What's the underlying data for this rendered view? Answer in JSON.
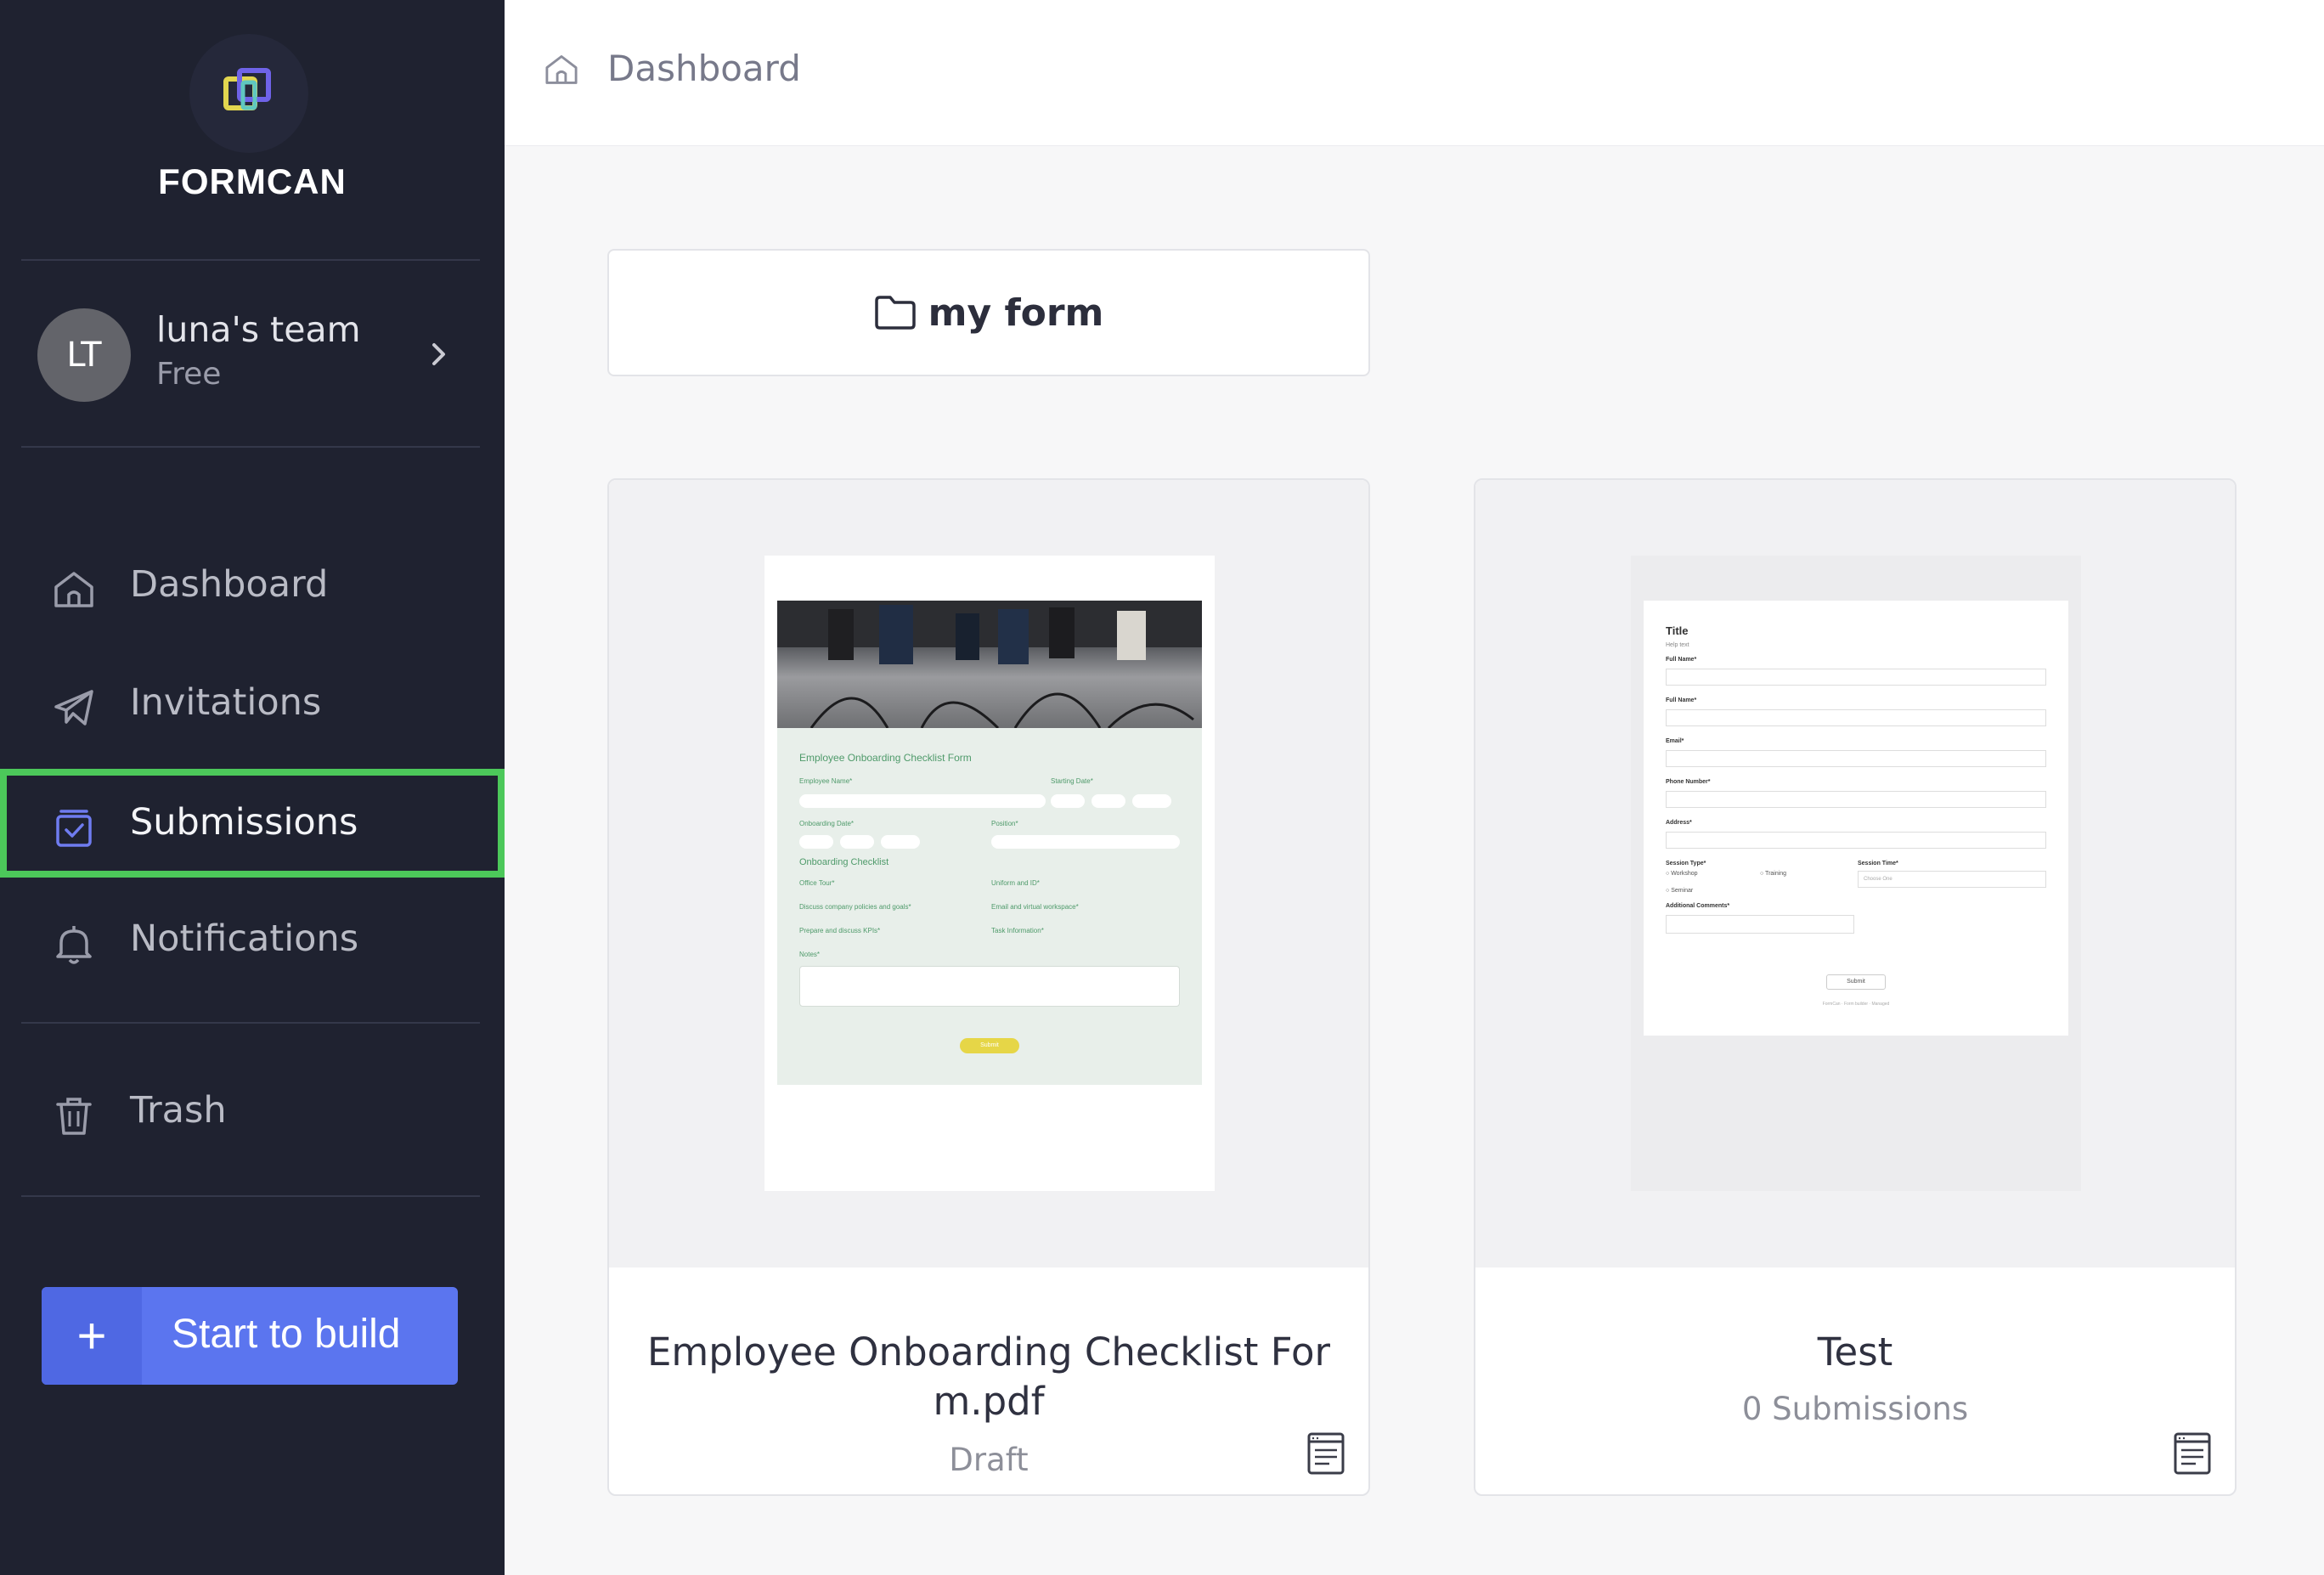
{
  "app": {
    "brand": "FORMCAN"
  },
  "team": {
    "initials": "LT",
    "name": "luna's team",
    "plan": "Free"
  },
  "nav": {
    "items": [
      {
        "label": "Dashboard",
        "icon": "home-icon"
      },
      {
        "label": "Invitations",
        "icon": "paper-plane-icon"
      },
      {
        "label": "Submissions",
        "icon": "inbox-check-icon",
        "active": true
      },
      {
        "label": "Notifications",
        "icon": "bell-icon"
      },
      {
        "label": "Trash",
        "icon": "trash-icon"
      }
    ],
    "build_plus": "+",
    "build_label": "Start to build"
  },
  "header": {
    "breadcrumb": "Dashboard"
  },
  "folder": {
    "label": "my form"
  },
  "cards": [
    {
      "title": "Employee Onboarding Checklist For m.pdf",
      "status": "Draft",
      "preview": {
        "form_title": "Employee Onboarding Checklist Form",
        "fields": [
          "Employee Name*",
          "Starting Date*",
          "Onboarding Date*",
          "Position*"
        ],
        "section": "Onboarding Checklist",
        "checklist": [
          "Office Tour*",
          "Uniform and ID*",
          "Discuss company policies and goals*",
          "Email and virtual workspace*",
          "Prepare and discuss KPIs*",
          "Task Information*"
        ],
        "notes": "Notes*",
        "submit": "Submit"
      }
    },
    {
      "title": "Test",
      "status": "0 Submissions",
      "preview": {
        "form_title": "Title",
        "help": "Help text",
        "fields": [
          "Full Name*",
          "Full Name*",
          "Email*",
          "Phone Number*",
          "Address*"
        ],
        "session_type": "Session Type*",
        "options": [
          "Workshop",
          "Training",
          "Seminar"
        ],
        "session_time": "Session Time*",
        "choose": "Choose One",
        "comments": "Additional Comments*",
        "submit": "Submit",
        "footer": "FormCan · Form builder · Managed"
      }
    }
  ],
  "colors": {
    "sidebar": "#1f2230",
    "accent": "#5b75ef",
    "active_border": "#4cc85a",
    "form_green": "#4e9a6a"
  }
}
